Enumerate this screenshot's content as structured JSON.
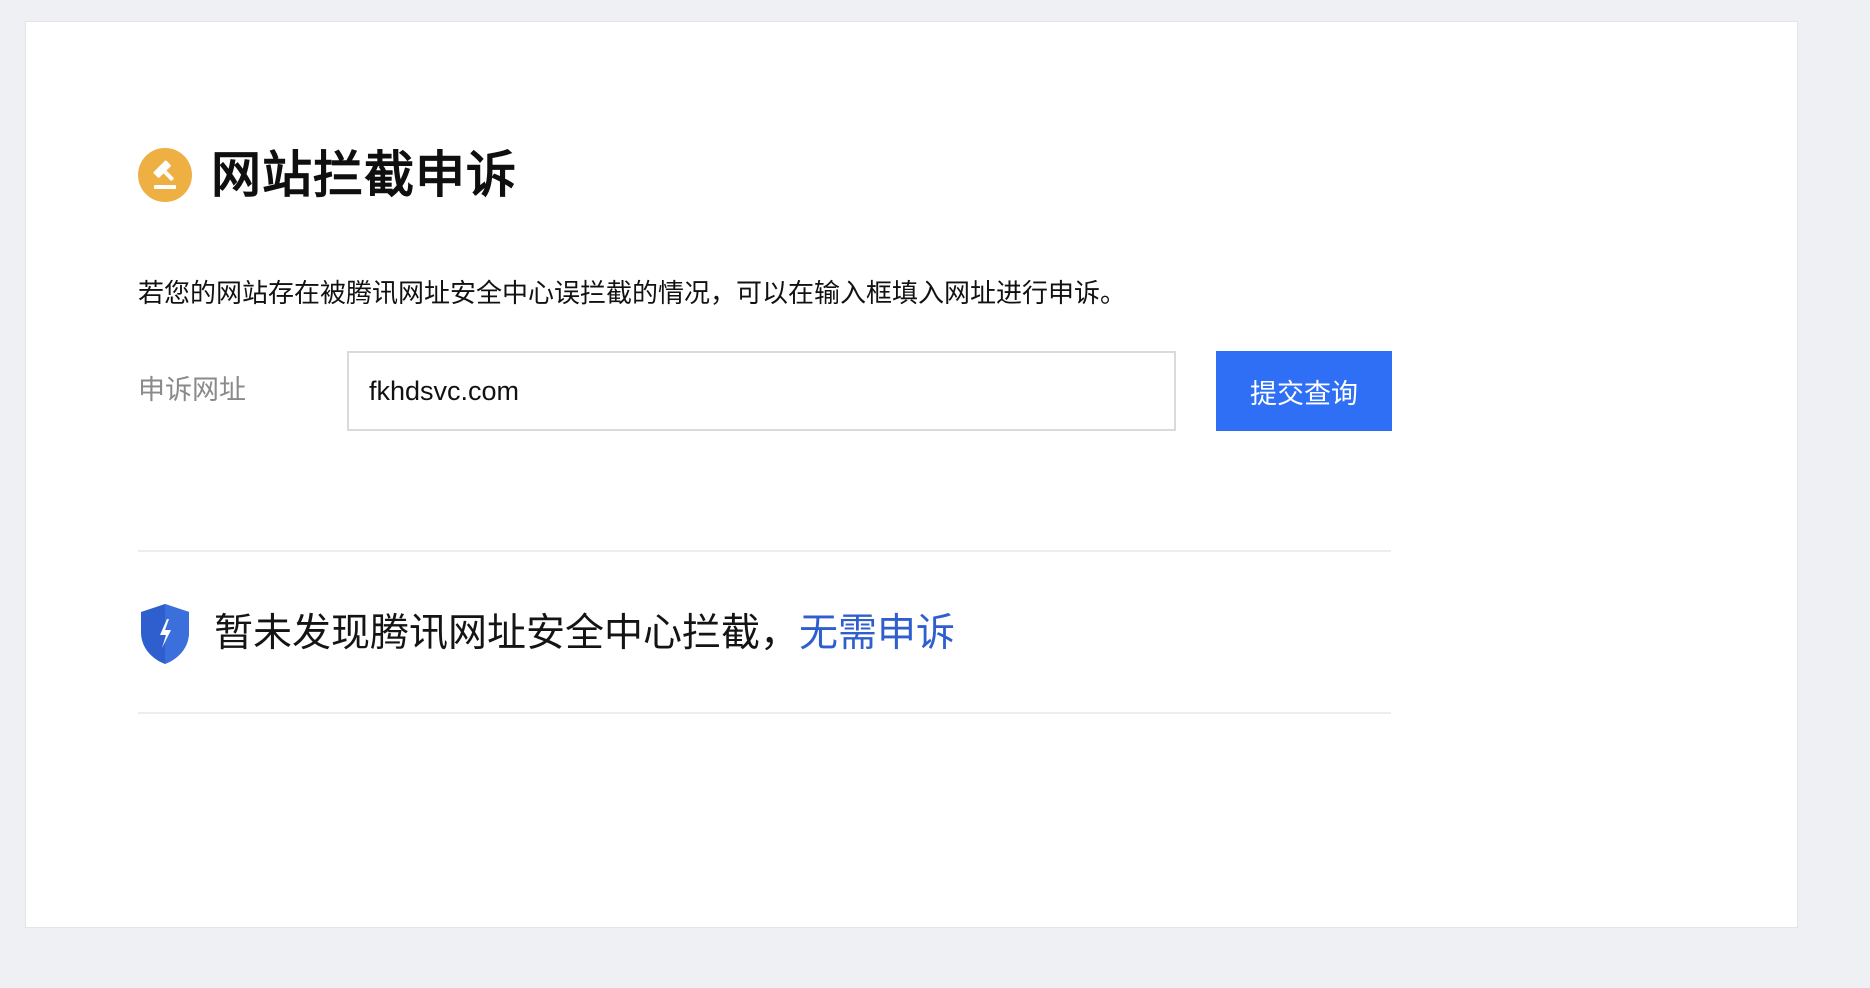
{
  "page": {
    "title": "网站拦截申诉",
    "title_icon": "gavel-icon",
    "description": "若您的网站存在被腾讯网址安全中心误拦截的情况，可以在输入框填入网址进行申诉。"
  },
  "form": {
    "label": "申诉网址",
    "url_value": "fkhdsvc.com",
    "submit_label": "提交查询"
  },
  "result": {
    "icon": "shield-icon",
    "message": "暂未发现腾讯网址安全中心拦截，",
    "link_text": "无需申诉"
  },
  "colors": {
    "background": "#eff0f4",
    "title_icon": "#eeb043",
    "button": "#2f6ff6",
    "link": "#2f5fcf",
    "shield": "#2f5fcf"
  }
}
